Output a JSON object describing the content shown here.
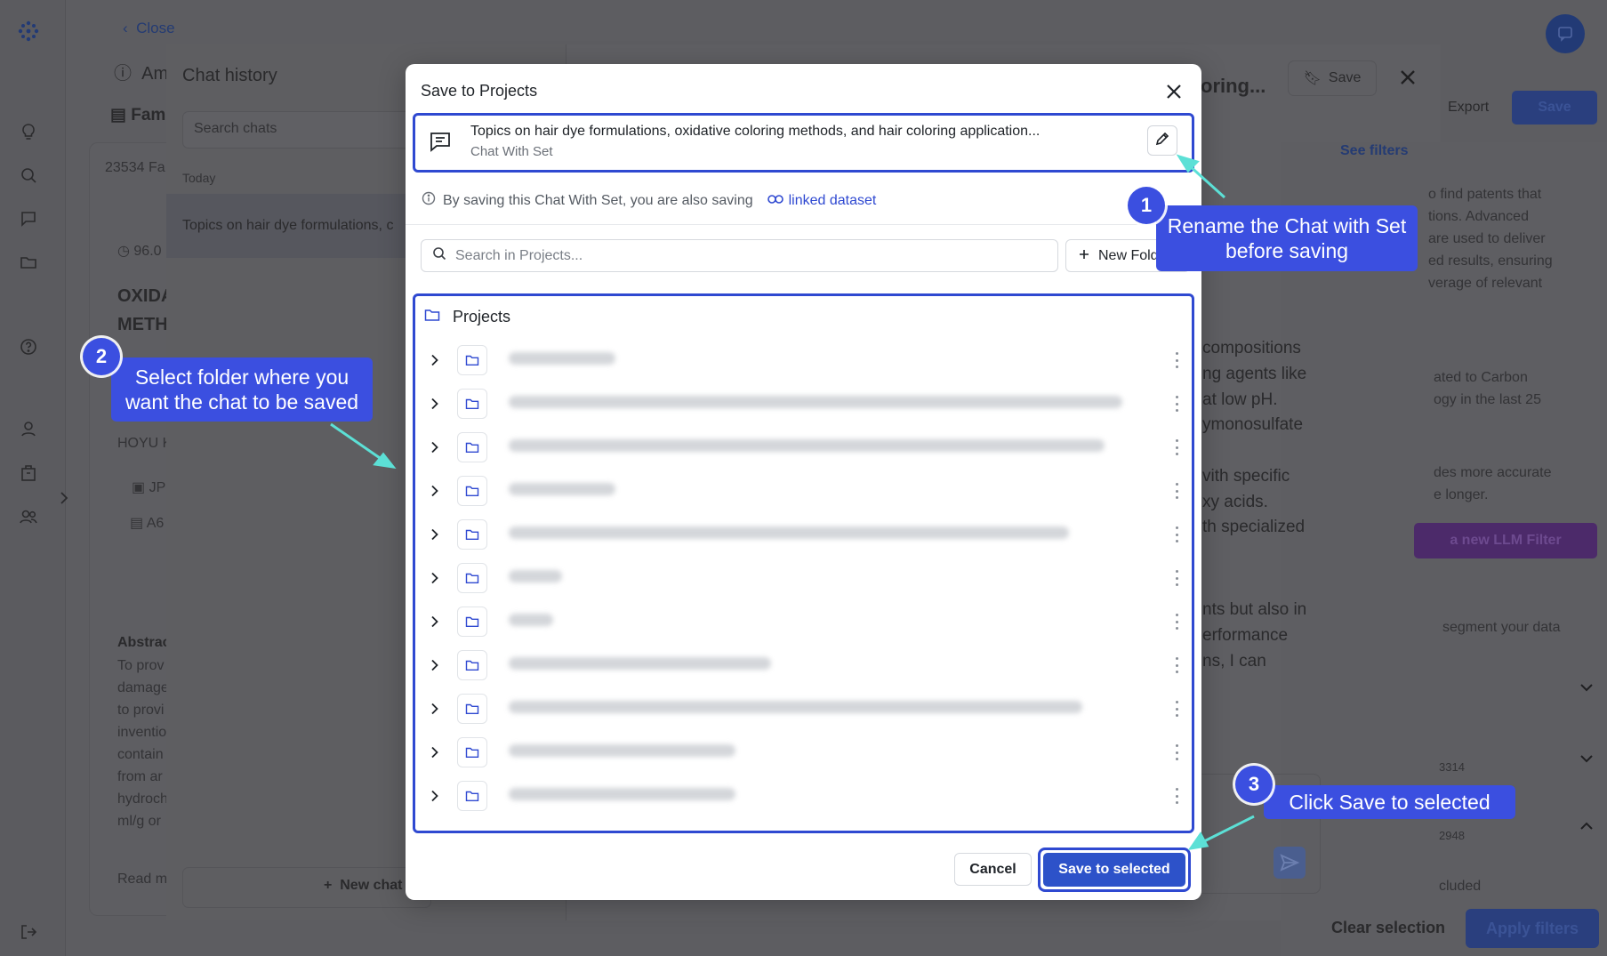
{
  "background": {
    "close_label": "Close",
    "page_title_partial": "Am",
    "tab_partial": "Fami",
    "count_partial": "23534 Fa",
    "score_partial": "96.0",
    "heading_line1": "OXIDA",
    "heading_line2": "METH",
    "hoyu_partial": "HOYU K",
    "jp_partial": "JP",
    "a6_partial": "A6",
    "abstract_partial": "Abstrac",
    "abstract_lines": [
      "To prov",
      "damage",
      "to provi",
      "inventio",
      "contain",
      "from ar",
      "hydroch",
      "ml/g or"
    ],
    "read_more_partial": "Read m",
    "history_title": "Chat history",
    "history_search_placeholder": "Search chats",
    "history_group": "Today",
    "history_item": "Topics on hair dye formulations, c",
    "new_chat_label": "New chat",
    "right_title_partial": "oring...",
    "save_label": "Save",
    "export_label": "Export",
    "save_blue_label": "Save",
    "see_filters": "See filters",
    "right_text_a": [
      "o find patents that",
      "tions. Advanced",
      "are used to deliver",
      "ed results, ensuring",
      "verage of relevant"
    ],
    "right_text_b": [
      "ated to Carbon",
      "ogy in the last 25"
    ],
    "right_text_c": [
      "des more accurate",
      "e longer."
    ],
    "llm_filter_partial": "a new LLM Filter",
    "segment_partial": "segment your data",
    "num_a": "3314",
    "num_b": "2948",
    "included_partial": "cluded",
    "clear_selection": "Clear selection",
    "apply_filters": "Apply filters",
    "chat_text": [
      "compositions",
      "ng agents like",
      "at low pH.",
      "ymonosulfate",
      "vith specific",
      "xy acids.",
      "th specialized",
      "nts but also in",
      "erformance",
      "ns, I can"
    ]
  },
  "modal": {
    "title": "Save to Projects",
    "chat_title": "Topics on hair dye formulations, oxidative coloring methods, and hair coloring application...",
    "chat_subtitle": "Chat With Set",
    "info_text": "By saving this Chat With Set, you are also saving",
    "info_link": "linked dataset",
    "search_placeholder": "Search in Projects...",
    "new_folder_label": "New Fold",
    "root_label": "Projects",
    "cancel_label": "Cancel",
    "save_label": "Save to selected"
  },
  "callouts": {
    "c1_number": "1",
    "c1_text": "Rename the Chat with Set before saving",
    "c2_number": "2",
    "c2_text": "Select folder where you want the chat to be saved",
    "c3_number": "3",
    "c3_text": "Click Save to selected"
  },
  "colors": {
    "accent": "#2f49d1",
    "callout": "#3b4fe0",
    "primary_button": "#2d52c9"
  }
}
